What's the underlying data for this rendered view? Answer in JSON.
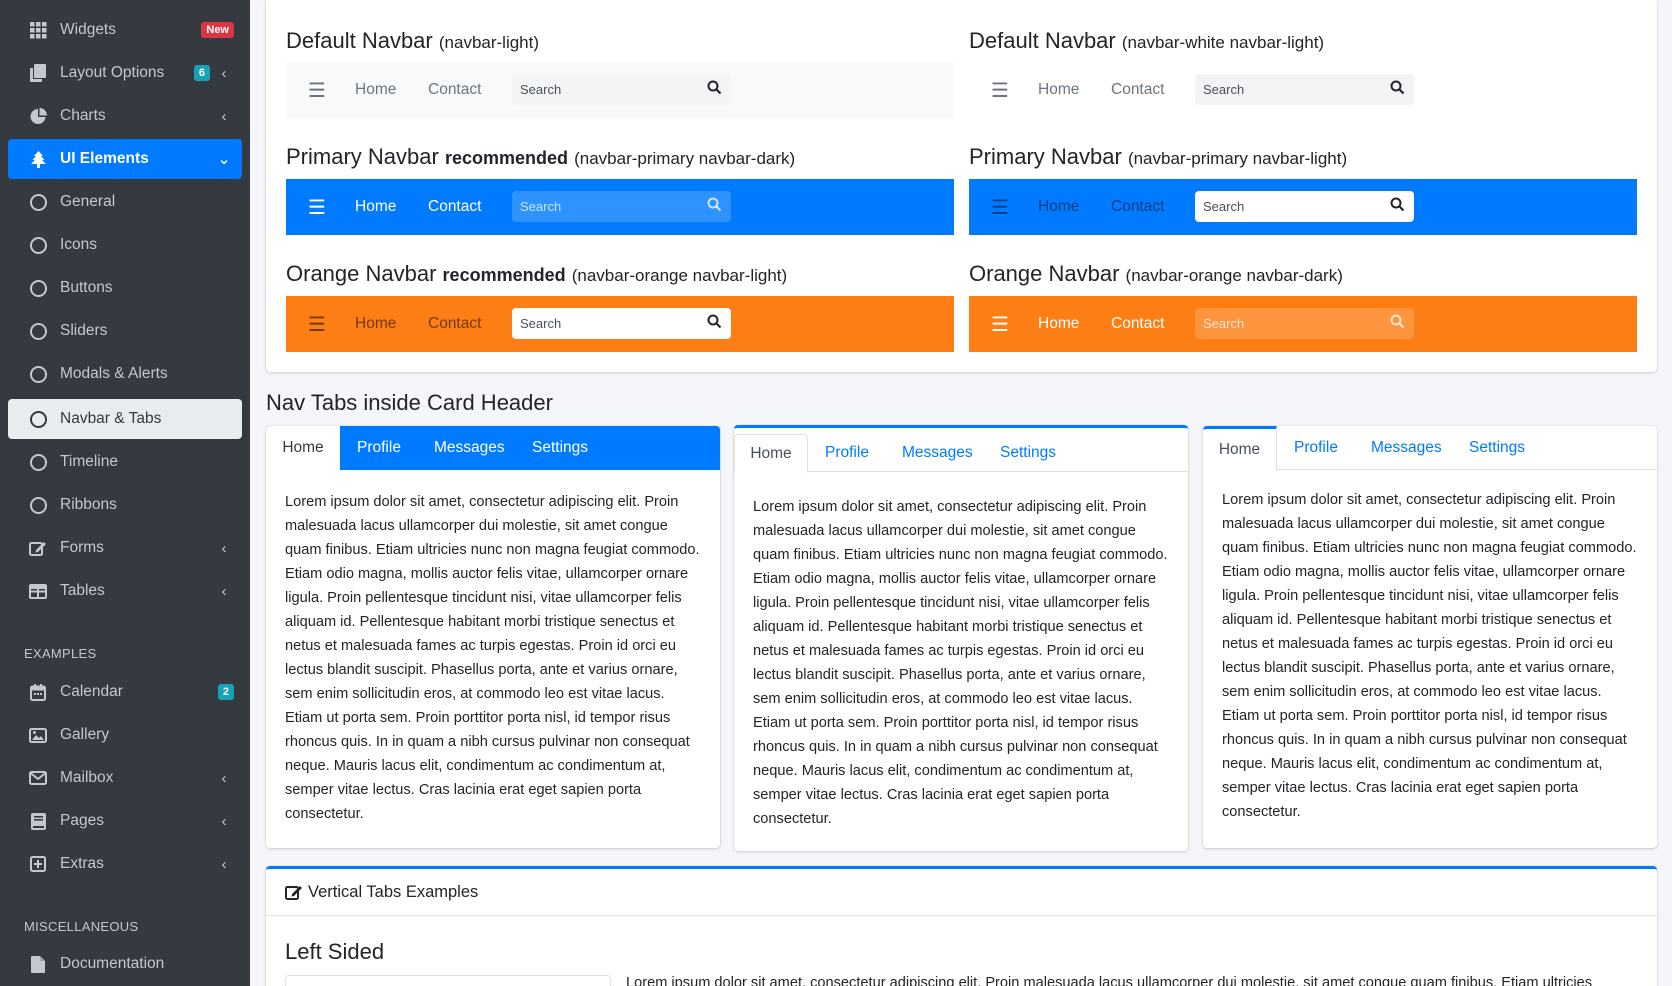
{
  "sidebar": {
    "items": [
      {
        "label": "Widgets",
        "badge": "New"
      },
      {
        "label": "Layout Options",
        "badge": "6"
      },
      {
        "label": "Charts"
      },
      {
        "label": "UI Elements"
      },
      {
        "label": "General"
      },
      {
        "label": "Icons"
      },
      {
        "label": "Buttons"
      },
      {
        "label": "Sliders"
      },
      {
        "label": "Modals & Alerts"
      },
      {
        "label": "Navbar & Tabs"
      },
      {
        "label": "Timeline"
      },
      {
        "label": "Ribbons"
      },
      {
        "label": "Forms"
      },
      {
        "label": "Tables"
      }
    ],
    "examples_header": "EXAMPLES",
    "examples": [
      {
        "label": "Calendar",
        "badge": "2"
      },
      {
        "label": "Gallery"
      },
      {
        "label": "Mailbox"
      },
      {
        "label": "Pages"
      },
      {
        "label": "Extras"
      }
    ],
    "misc_header": "MISCELLANEOUS",
    "misc": [
      {
        "label": "Documentation"
      }
    ]
  },
  "navbars": [
    {
      "title": "Default Navbar",
      "bold": "",
      "suffix": "(navbar-light)",
      "home": "Home",
      "contact": "Contact",
      "search": "Search"
    },
    {
      "title": "Default Navbar",
      "bold": "",
      "suffix": "(navbar-white navbar-light)",
      "home": "Home",
      "contact": "Contact",
      "search": "Search"
    },
    {
      "title": "Primary Navbar",
      "bold": "recommended",
      "suffix": "(navbar-primary navbar-dark)",
      "home": "Home",
      "contact": "Contact",
      "search": "Search"
    },
    {
      "title": "Primary Navbar",
      "bold": "",
      "suffix": "(navbar-primary navbar-light)",
      "home": "Home",
      "contact": "Contact",
      "search": "Search"
    },
    {
      "title": "Orange Navbar",
      "bold": "recommended",
      "suffix": "(navbar-orange navbar-light)",
      "home": "Home",
      "contact": "Contact",
      "search": "Search"
    },
    {
      "title": "Orange Navbar",
      "bold": "",
      "suffix": "(navbar-orange navbar-dark)",
      "home": "Home",
      "contact": "Contact",
      "search": "Search"
    }
  ],
  "tabs_section_title": "Nav Tabs inside Card Header",
  "tabcards": [
    {
      "tabs": [
        "Home",
        "Profile",
        "Messages",
        "Settings"
      ],
      "body": "Lorem ipsum dolor sit amet, consectetur adipiscing elit. Proin malesuada lacus ullamcorper dui molestie, sit amet congue quam finibus. Etiam ultricies nunc non magna feugiat commodo. Etiam odio magna, mollis auctor felis vitae, ullamcorper ornare ligula. Proin pellentesque tincidunt nisi, vitae ullamcorper felis aliquam id. Pellentesque habitant morbi tristique senectus et netus et malesuada fames ac turpis egestas. Proin id orci eu lectus blandit suscipit. Phasellus porta, ante et varius ornare, sem enim sollicitudin eros, at commodo leo est vitae lacus. Etiam ut porta sem. Proin porttitor porta nisl, id tempor risus rhoncus quis. In in quam a nibh cursus pulvinar non consequat neque. Mauris lacus elit, condimentum ac condimentum at, semper vitae lectus. Cras lacinia erat eget sapien porta consectetur."
    },
    {
      "tabs": [
        "Home",
        "Profile",
        "Messages",
        "Settings"
      ],
      "body": "Lorem ipsum dolor sit amet, consectetur adipiscing elit. Proin malesuada lacus ullamcorper dui molestie, sit amet congue quam finibus. Etiam ultricies nunc non magna feugiat commodo. Etiam odio magna, mollis auctor felis vitae, ullamcorper ornare ligula. Proin pellentesque tincidunt nisi, vitae ullamcorper felis aliquam id. Pellentesque habitant morbi tristique senectus et netus et malesuada fames ac turpis egestas. Proin id orci eu lectus blandit suscipit. Phasellus porta, ante et varius ornare, sem enim sollicitudin eros, at commodo leo est vitae lacus. Etiam ut porta sem. Proin porttitor porta nisl, id tempor risus rhoncus quis. In in quam a nibh cursus pulvinar non consequat neque. Mauris lacus elit, condimentum ac condimentum at, semper vitae lectus. Cras lacinia erat eget sapien porta consectetur."
    },
    {
      "tabs": [
        "Home",
        "Profile",
        "Messages",
        "Settings"
      ],
      "body": "Lorem ipsum dolor sit amet, consectetur adipiscing elit. Proin malesuada lacus ullamcorper dui molestie, sit amet congue quam finibus. Etiam ultricies nunc non magna feugiat commodo. Etiam odio magna, mollis auctor felis vitae, ullamcorper ornare ligula. Proin pellentesque tincidunt nisi, vitae ullamcorper felis aliquam id. Pellentesque habitant morbi tristique senectus et netus et malesuada fames ac turpis egestas. Proin id orci eu lectus blandit suscipit. Phasellus porta, ante et varius ornare, sem enim sollicitudin eros, at commodo leo est vitae lacus. Etiam ut porta sem. Proin porttitor porta nisl, id tempor risus rhoncus quis. In in quam a nibh cursus pulvinar non consequat neque. Mauris lacus elit, condimentum ac condimentum at, semper vitae lectus. Cras lacinia erat eget sapien porta consectetur."
    }
  ],
  "vertical": {
    "title": "Vertical Tabs Examples",
    "left_sided": "Left Sided",
    "body_preview": "Lorem ipsum dolor sit amet, consectetur adipiscing elit. Proin malesuada lacus ullamcorper dui molestie, sit amet congue quam finibus. Etiam ultricies"
  },
  "colors": {
    "primary": "#007bff",
    "orange": "#fd7e14",
    "sidebar": "#343a40",
    "danger": "#dc3545",
    "info": "#17a2b8"
  }
}
